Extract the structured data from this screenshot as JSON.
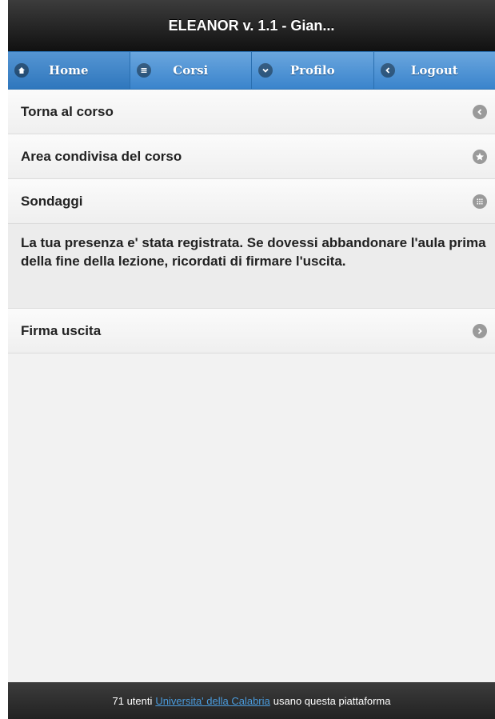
{
  "header": {
    "title": "ELEANOR v. 1.1 - Gian..."
  },
  "navbar": {
    "items": [
      {
        "label": "Home",
        "icon": "home-icon"
      },
      {
        "label": "Corsi",
        "icon": "menu-icon"
      },
      {
        "label": "Profilo",
        "icon": "chevron-down-icon"
      },
      {
        "label": "Logout",
        "icon": "chevron-left-icon"
      }
    ],
    "active_index": 0
  },
  "list": {
    "items": [
      {
        "label": "Torna al corso",
        "icon": "chevron-left-icon"
      },
      {
        "label": "Area condivisa del corso",
        "icon": "star-icon"
      },
      {
        "label": "Sondaggi",
        "icon": "grid-icon"
      }
    ],
    "message": "La tua presenza e' stata registrata. Se dovessi abbandonare l'aula prima della fine della lezione, ricordati di firmare l'uscita.",
    "action": {
      "label": "Firma uscita",
      "icon": "chevron-right-icon"
    }
  },
  "footer": {
    "prefix": "71 utenti",
    "link": "Universita' della Calabria",
    "suffix": "usano questa piattaforma"
  },
  "colors": {
    "navbar": "#3a84cc",
    "header": "#111111",
    "link": "#4a9bdc"
  }
}
